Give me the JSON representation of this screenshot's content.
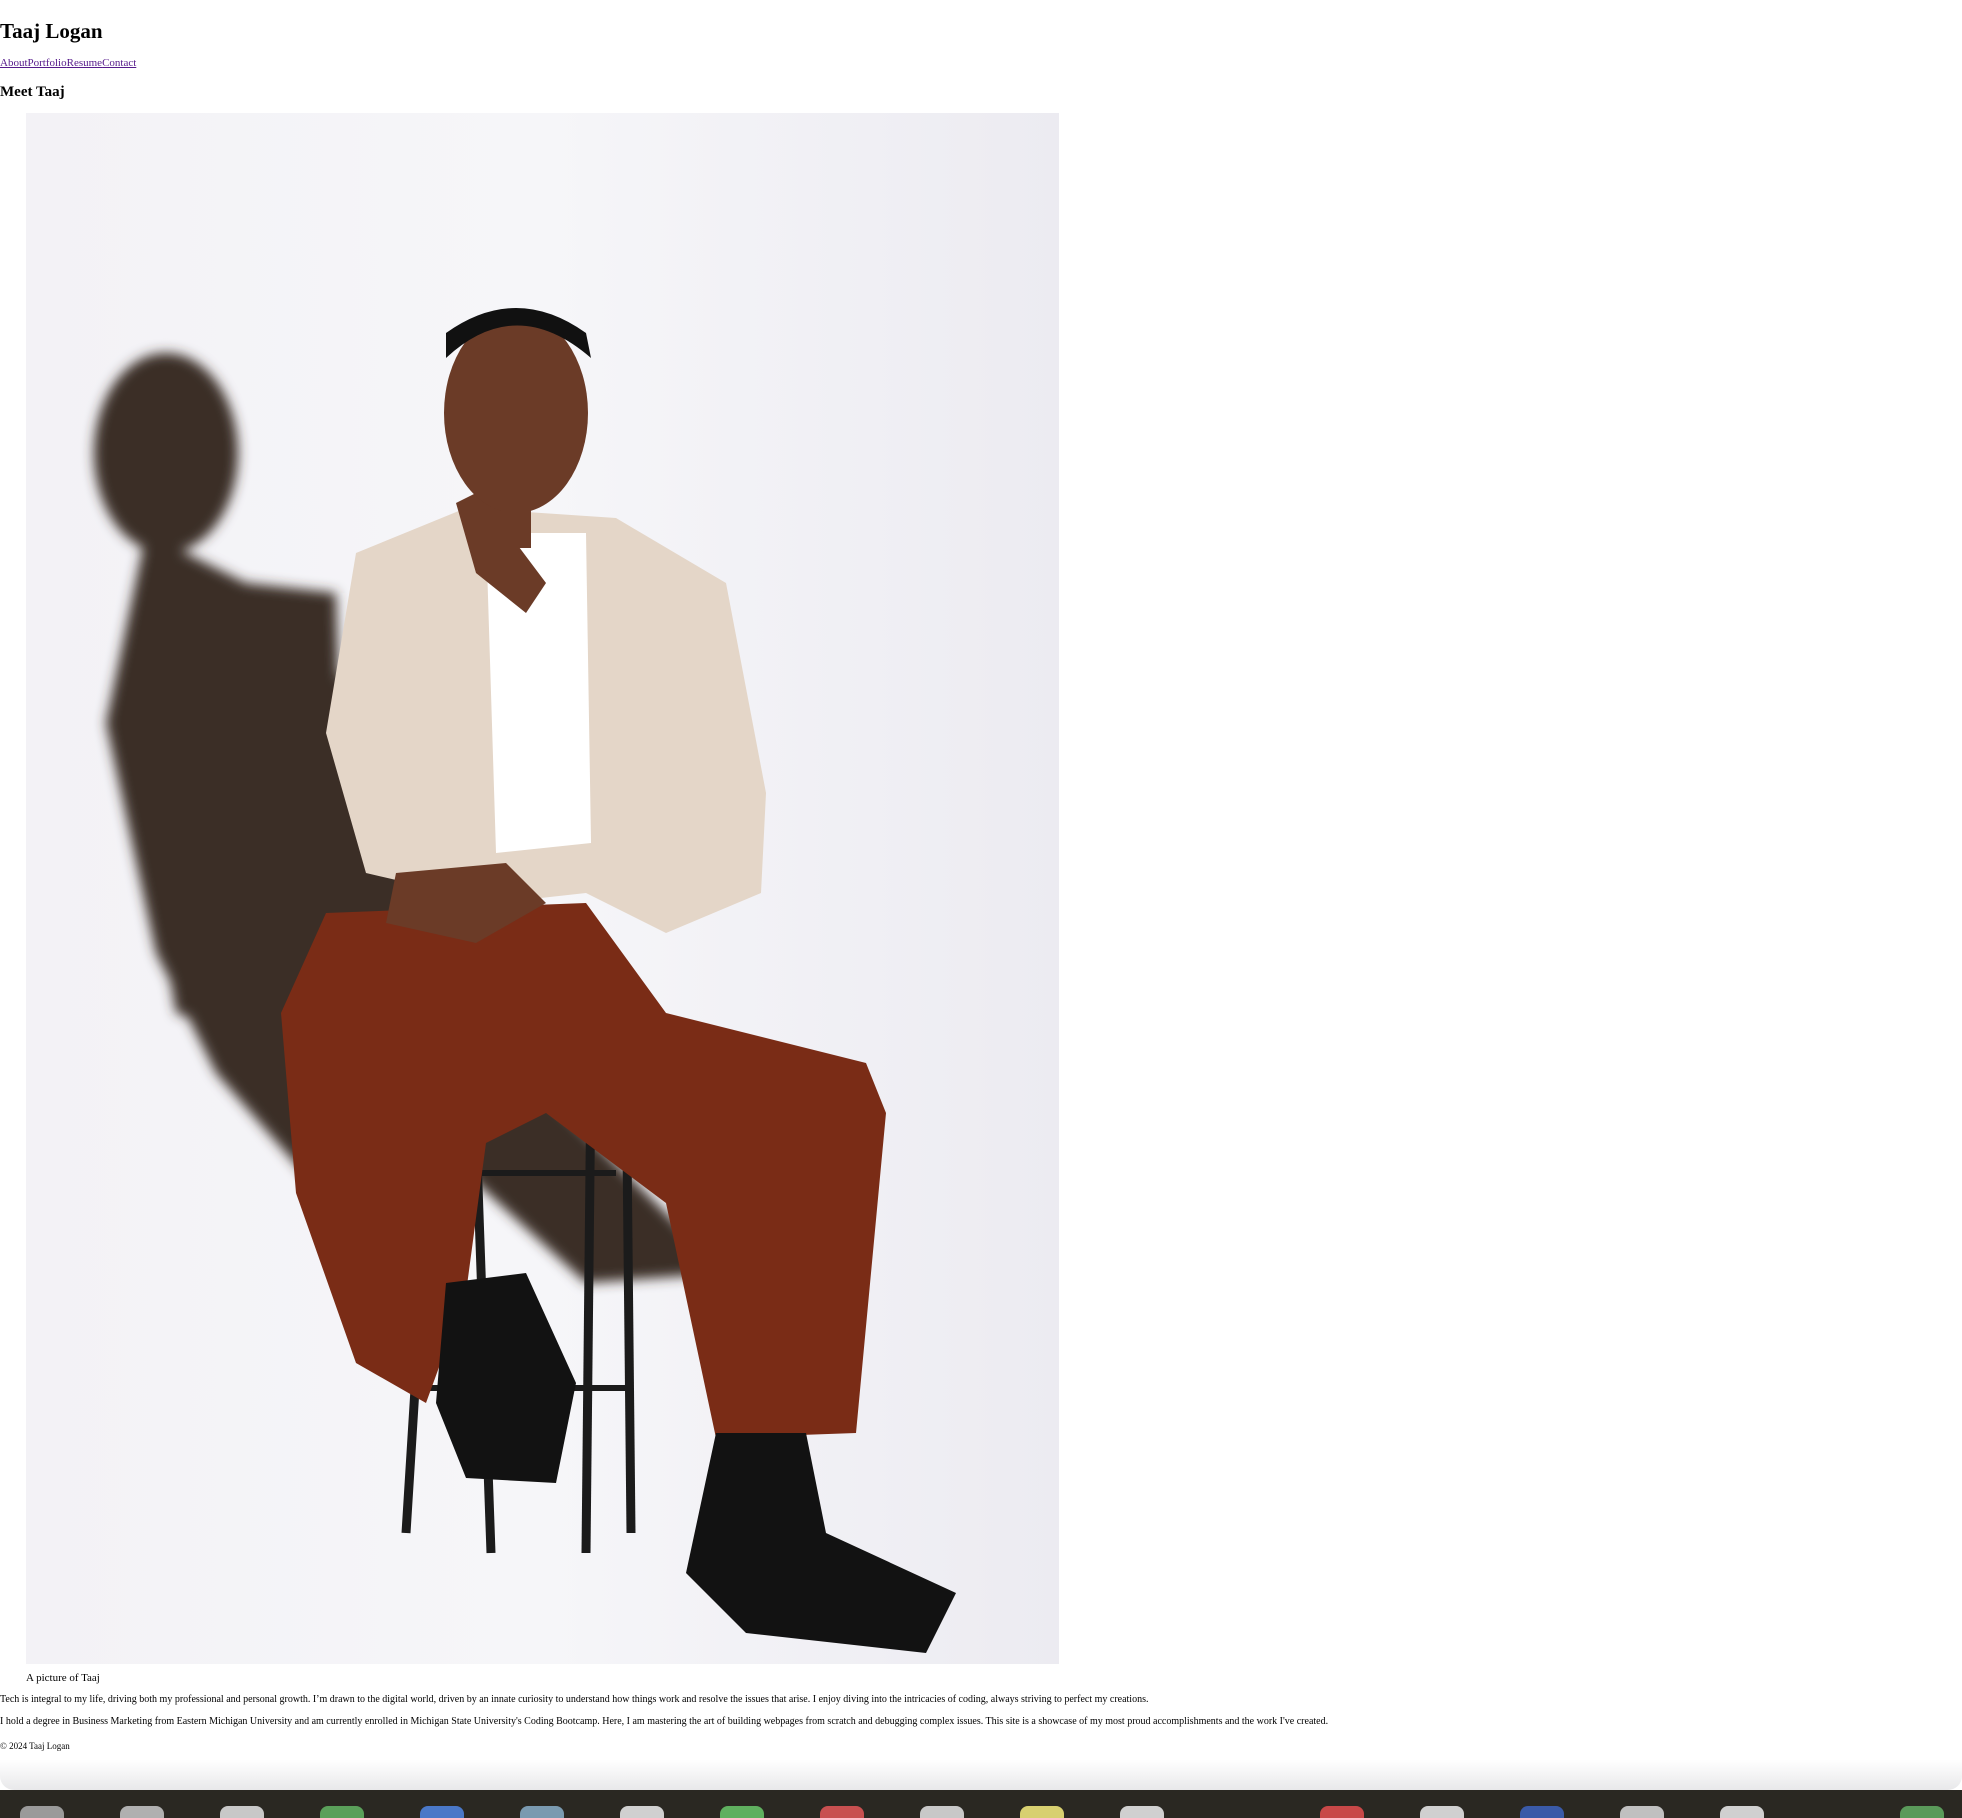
{
  "header": {
    "title": "Taaj Logan"
  },
  "nav": {
    "items": [
      "About",
      "Portfolio",
      "Resume",
      "Contact"
    ]
  },
  "section": {
    "title": "Meet Taaj"
  },
  "figure": {
    "caption": "A picture of Taaj"
  },
  "bio": {
    "paragraph1": "Tech is integral to my life, driving both my professional and personal growth. I’m drawn to the digital world, driven by an innate curiosity to understand how things work and resolve the issues that arise. I enjoy diving into the intricacies of coding, always striving to perfect my creations.",
    "paragraph2": "I hold a degree in Business Marketing from Eastern Michigan University and am currently enrolled in Michigan State University's Coding Bootcamp. Here, I am mastering the art of building webpages from scratch and debugging complex issues. This site is a showcase of my most proud accomplishments and the work I've created."
  },
  "footer": {
    "text": "© 2024 Taaj Logan"
  },
  "colors": {
    "link": "#551a8b",
    "photo_background": "#f3f2f6",
    "cardigan": "#e4d6c8",
    "pants": "#7a2c16",
    "shadow": "#3a2e26",
    "dock": "#2a2822"
  }
}
